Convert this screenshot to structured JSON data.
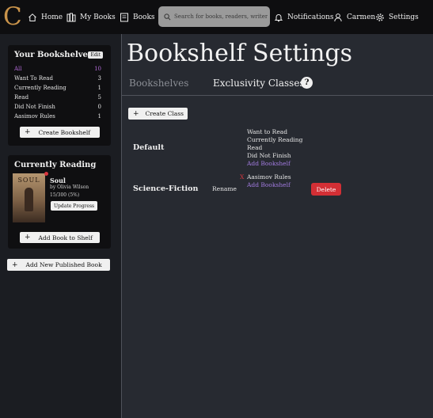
{
  "nav": {
    "logo": "C",
    "home": "Home",
    "my_books": "My Books",
    "books": "Books",
    "search_placeholder": "Search for books, readers, writers ...",
    "notifications": "Notifications",
    "user": "Carmen",
    "settings": "Settings"
  },
  "sidebar": {
    "bookshelves_title": "Your Bookshelves",
    "edit_label": "Edit",
    "shelves": [
      {
        "name": "All",
        "count": "10"
      },
      {
        "name": "Want To Read",
        "count": "3"
      },
      {
        "name": "Currently Reading",
        "count": "1"
      },
      {
        "name": "Read",
        "count": "5"
      },
      {
        "name": "Did Not Finish",
        "count": "0"
      },
      {
        "name": "Aasimov Rules",
        "count": "1"
      }
    ],
    "create_bookshelf": "Create Bookshelf",
    "currently_reading_title": "Currently Reading",
    "book": {
      "cover_text": "SOUL",
      "title": "Soul",
      "author": "by Olivia Wilson",
      "progress": "15/300 (5%)",
      "update_progress": "Update Progress"
    },
    "add_book_to_shelf": "Add Book to Shelf",
    "add_published_book": "Add New Published Book"
  },
  "main": {
    "title": "Bookshelf Settings",
    "tabs": [
      "Bookshelves",
      "Exclusivity Classes"
    ],
    "help": "?",
    "create_class": "Create Class",
    "classes": [
      {
        "name": "Default",
        "shelves": [
          "Want to Read",
          "Currently Reading",
          "Read",
          "Did Not Finish"
        ],
        "add_link": "Add Bookshelf"
      },
      {
        "name": "Science-Fiction",
        "rename": "Rename",
        "remove_mark": "X",
        "shelves": [
          "Aasimov Rules"
        ],
        "add_link": "Add Bookshelf",
        "delete": "Delete"
      }
    ]
  },
  "colors": {
    "accent_purple": "#b26ad8",
    "link_purple": "#a27be0",
    "danger_red": "#d32f35",
    "logo_orange": "#c9934a"
  }
}
